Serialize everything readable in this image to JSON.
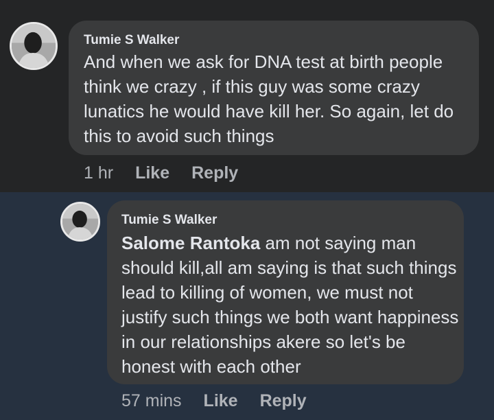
{
  "comment": {
    "author": "Tumie S Walker",
    "text": "And when we ask for DNA test at birth people think we crazy , if this guy was some crazy lunatics he would have kill her. So again, let do this to avoid such things",
    "time": "1 hr",
    "like_label": "Like",
    "reply_label": "Reply"
  },
  "reply": {
    "author": "Tumie S Walker",
    "mention": "Salome Rantoka",
    "text": " am not saying man should kill,all am saying is that such things lead to killing of women, we must not justify such things we both want happiness in our relationships akere so let's be honest with each other",
    "time": "57 mins",
    "like_label": "Like",
    "reply_label": "Reply"
  },
  "colors": {
    "top_background": "#242526",
    "reply_background": "#263140",
    "bubble": "#3a3b3c",
    "text": "#e4e6eb",
    "muted": "#b0b3b8"
  },
  "icons": {
    "avatar": "profile-photo"
  }
}
